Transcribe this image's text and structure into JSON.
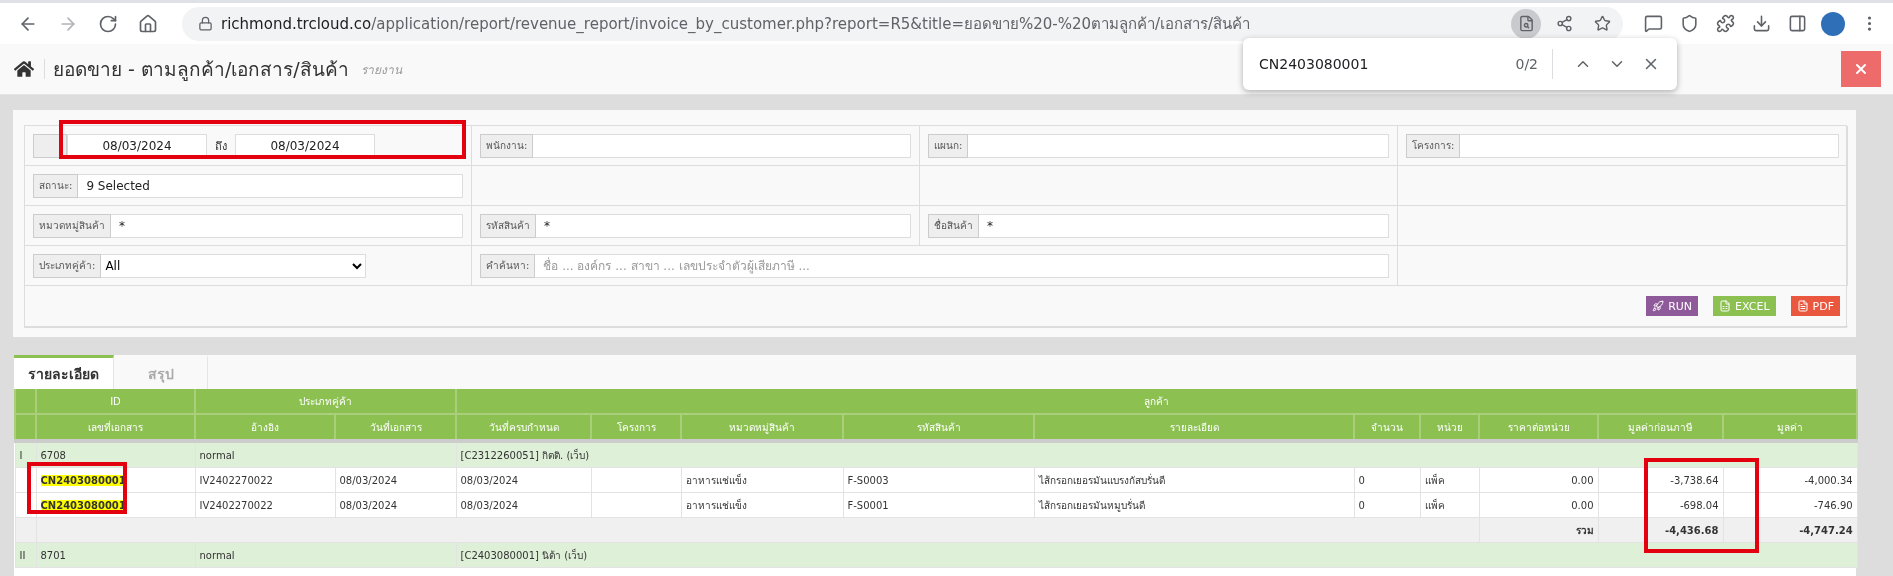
{
  "browser": {
    "nav": [
      {
        "kind": "back",
        "disabled": false
      },
      {
        "kind": "forward",
        "disabled": true
      },
      {
        "kind": "reload",
        "disabled": false
      },
      {
        "kind": "home",
        "disabled": false
      }
    ],
    "url": {
      "host": "richmond.trcloud.co",
      "path": "/application/report/revenue_report/invoice_by_customer.php?report=R5&title=ยอดขาย%20-%20ตามลูกค้า/เอกสาร/สินค้า"
    },
    "address_actions": [
      {
        "kind": "find",
        "active": true
      },
      {
        "kind": "share",
        "active": false
      },
      {
        "kind": "star",
        "active": false
      }
    ],
    "extensions": [
      {
        "kind": "chat"
      },
      {
        "kind": "shield"
      },
      {
        "kind": "puzzle"
      },
      {
        "kind": "download"
      },
      {
        "kind": "sidebar"
      },
      {
        "kind": "avatar"
      },
      {
        "kind": "menu"
      }
    ],
    "find_bar": {
      "query": "CN2403080001",
      "count": "0/2"
    }
  },
  "header": {
    "title": "ยอดขาย - ตามลูกค้า/เอกสาร/สินค้า",
    "subtitle": "รายงาน"
  },
  "filters": {
    "rows": [
      [
        {
          "kind": "daterange",
          "from": "08/03/2024",
          "to_label": "ถึง",
          "to": "08/03/2024"
        },
        {
          "kind": "field",
          "label": "พนักงาน:"
        },
        {
          "kind": "field",
          "label": "แผนก:"
        },
        {
          "kind": "field",
          "label": "โครงการ:"
        }
      ],
      [
        {
          "kind": "field",
          "label": "สถานะ:",
          "value": "9 Selected"
        },
        {
          "kind": "empty"
        },
        {
          "kind": "empty"
        },
        {
          "kind": "empty"
        }
      ],
      [
        {
          "kind": "field",
          "label": "หมวดหมู่สินค้า",
          "value": "*"
        },
        {
          "kind": "field",
          "label": "รหัสสินค้า",
          "value": "*"
        },
        {
          "kind": "field",
          "label": "ชื่อสินค้า",
          "value": "*"
        },
        {
          "kind": "empty"
        }
      ],
      [
        {
          "kind": "select",
          "label": "ประเภทคู่ค้า:",
          "value": "All"
        },
        {
          "kind": "search",
          "label": "คำค้นหา:",
          "placeholder": "ชื่อ ... องค์กร ... สาขา ... เลขประจำตัวผู้เสียภาษี ..."
        },
        {
          "kind": "empty"
        }
      ]
    ],
    "buttons": [
      {
        "kind": "run",
        "label": "RUN"
      },
      {
        "kind": "excel",
        "label": "EXCEL"
      },
      {
        "kind": "pdf",
        "label": "PDF"
      }
    ]
  },
  "tabs": [
    {
      "label": "รายละเอียด",
      "selected": true
    },
    {
      "label": "สรุป",
      "selected": false
    }
  ],
  "table": {
    "header_groups": [
      "ID",
      "ประเภทคู่ค้า",
      "ลูกค้า"
    ],
    "columns": [
      "เลขที่เอกสาร",
      "อ้างอิง",
      "วันที่เอกสาร",
      "วันที่ครบกำหนด",
      "โครงการ",
      "หมวดหมู่สินค้า",
      "รหัสสินค้า",
      "รายละเอียด",
      "จำนวน",
      "หน่วย",
      "ราคาต่อหน่วย",
      "มูลค่าก่อนภาษี",
      "มูลค่า"
    ],
    "groups": [
      {
        "index": "I",
        "id": "6708",
        "partner_type": "normal",
        "customer": "[C2312260051] กิตติ. (เว็บ)",
        "rows": [
          {
            "doc_no": "CN2403080001",
            "highlighted": true,
            "ref": "IV2402270022",
            "doc_date": "08/03/2024",
            "due_date": "08/03/2024",
            "category": "อาหารแช่แข็ง",
            "sku": "F-S0003",
            "description": "ไส้กรอกเยอรมันแบรงกัสบรั่นดี",
            "qty": "0",
            "unit": "แพ็ค",
            "unit_price": "0.00",
            "pretax": "-3,738.64",
            "amount": "-4,000.34"
          },
          {
            "doc_no": "CN2403080001",
            "highlighted": true,
            "ref": "IV2402270022",
            "doc_date": "08/03/2024",
            "due_date": "08/03/2024",
            "category": "อาหารแช่แข็ง",
            "sku": "F-S0001",
            "description": "ไส้กรอกเยอรมันหมูบรั่นดี",
            "qty": "0",
            "unit": "แพ็ค",
            "unit_price": "0.00",
            "pretax": "-698.04",
            "amount": "-746.90"
          }
        ],
        "total": {
          "label": "รวม",
          "pretax": "-4,436.68",
          "amount": "-4,747.24"
        }
      },
      {
        "index": "II",
        "id": "8701",
        "partner_type": "normal",
        "customer": "[C2403080001] นิต้า (เว็บ)"
      }
    ]
  },
  "annotation_frames": [
    {
      "kind": "frame"
    },
    {
      "kind": "frame"
    },
    {
      "kind": "frame"
    }
  ]
}
